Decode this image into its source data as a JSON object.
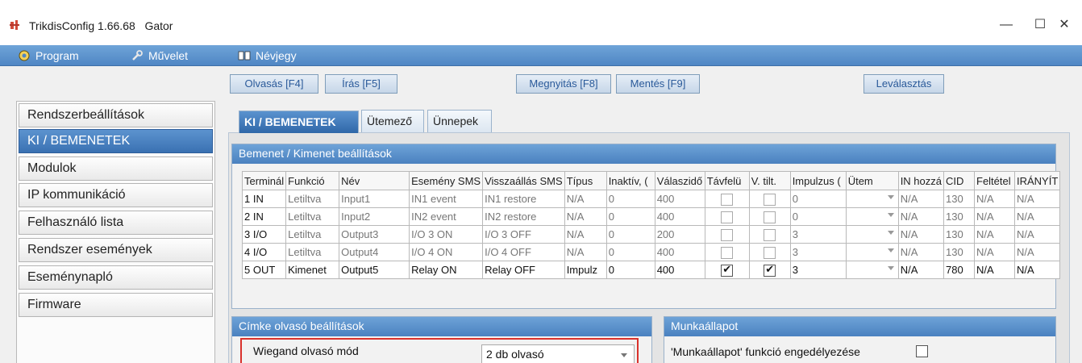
{
  "window": {
    "app_name": "TrikdisConfig 1.66.68",
    "device": "Gator",
    "minimize_glyph": "—",
    "maximize_glyph": "☐",
    "close_glyph": "✕"
  },
  "menu": {
    "program": "Program",
    "action": "Művelet",
    "about": "Névjegy"
  },
  "toolbar": {
    "read": "Olvasás [F4]",
    "write": "Írás [F5]",
    "open": "Megnyitás [F8]",
    "save": "Mentés [F9]",
    "disconnect": "Leválasztás"
  },
  "nav": [
    "Rendszerbeállítások",
    "KI / BEMENETEK",
    "Modulok",
    "IP kommunikáció",
    "Felhasználó lista",
    "Rendszer események",
    "Eseménynapló",
    "Firmware"
  ],
  "nav_active_index": 1,
  "tabs": [
    "KI / BEMENETEK",
    "Ütemező",
    "Ünnepek"
  ],
  "io_panel": {
    "title": "Bemenet / Kimenet beállítások",
    "columns": [
      "Terminál",
      "Funkció",
      "Név",
      "Esemény SMS",
      "Visszaállás SMS",
      "Típus",
      "Inaktív, (",
      "Válaszidő",
      "Távfelü",
      "V. tilt.",
      "Impulzus (",
      "Ütem",
      "IN hozzá",
      "CID",
      "Feltétel",
      "IRÁNYÍT"
    ],
    "rows": [
      {
        "terminal": "1 IN",
        "function": "Letiltva",
        "name": "Input1",
        "event_sms": "IN1 event",
        "restore_sms": "IN1 restore",
        "type": "N/A",
        "inactive": "0",
        "response": "400",
        "remote": false,
        "block": false,
        "pulse": "0",
        "schedule": "",
        "in_assign": "N/A",
        "cid": "130",
        "condition": "N/A",
        "control": "N/A",
        "enabled": false
      },
      {
        "terminal": "2 IN",
        "function": "Letiltva",
        "name": "Input2",
        "event_sms": "IN2 event",
        "restore_sms": "IN2 restore",
        "type": "N/A",
        "inactive": "0",
        "response": "400",
        "remote": false,
        "block": false,
        "pulse": "0",
        "schedule": "",
        "in_assign": "N/A",
        "cid": "130",
        "condition": "N/A",
        "control": "N/A",
        "enabled": false
      },
      {
        "terminal": "3 I/O",
        "function": "Letiltva",
        "name": "Output3",
        "event_sms": "I/O 3 ON",
        "restore_sms": "I/O 3 OFF",
        "type": "N/A",
        "inactive": "0",
        "response": "200",
        "remote": false,
        "block": false,
        "pulse": "3",
        "schedule": "",
        "in_assign": "N/A",
        "cid": "130",
        "condition": "N/A",
        "control": "N/A",
        "enabled": false
      },
      {
        "terminal": "4 I/O",
        "function": "Letiltva",
        "name": "Output4",
        "event_sms": "I/O 4 ON",
        "restore_sms": "I/O 4 OFF",
        "type": "N/A",
        "inactive": "0",
        "response": "400",
        "remote": false,
        "block": false,
        "pulse": "3",
        "schedule": "",
        "in_assign": "N/A",
        "cid": "130",
        "condition": "N/A",
        "control": "N/A",
        "enabled": false
      },
      {
        "terminal": "5 OUT",
        "function": "Kimenet",
        "name": "Output5",
        "event_sms": "Relay ON",
        "restore_sms": "Relay OFF",
        "type": "Impulz",
        "inactive": "0",
        "response": "400",
        "remote": true,
        "block": true,
        "pulse": "3",
        "schedule": "",
        "in_assign": "N/A",
        "cid": "780",
        "condition": "N/A",
        "control": "N/A",
        "enabled": true
      }
    ]
  },
  "reader_panel": {
    "title": "Címke olvasó beállítások",
    "wiegand_label": "Wiegand olvasó mód",
    "wiegand_value": "2 db olvasó"
  },
  "state_panel": {
    "title": "Munkaállapot",
    "enable_label": "'Munkaállapot' funkció engedélyezése",
    "enable_checked": false
  }
}
